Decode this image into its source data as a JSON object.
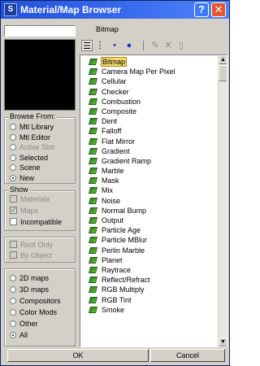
{
  "window": {
    "title": "Material/Map Browser",
    "help_label": "?",
    "close_label": "✕",
    "icon_label": "S"
  },
  "path": "Bitmap",
  "browse_from": {
    "title": "Browse From:",
    "options": [
      {
        "label": "Mtl Library",
        "selected": false,
        "enabled": true
      },
      {
        "label": "Mtl Editor",
        "selected": false,
        "enabled": true
      },
      {
        "label": "Active Slot",
        "selected": false,
        "enabled": false
      },
      {
        "label": "Selected",
        "selected": false,
        "enabled": true
      },
      {
        "label": "Scene",
        "selected": false,
        "enabled": true
      },
      {
        "label": "New",
        "selected": true,
        "enabled": true
      }
    ]
  },
  "show": {
    "title": "Show",
    "options": [
      {
        "label": "Materials",
        "checked": false,
        "enabled": false
      },
      {
        "label": "Maps",
        "checked": true,
        "enabled": false
      },
      {
        "label": "Incompatible",
        "checked": false,
        "enabled": true
      }
    ]
  },
  "filters": {
    "options": [
      {
        "label": "Root Only",
        "checked": false,
        "enabled": false
      },
      {
        "label": "By Object",
        "checked": false,
        "enabled": false
      }
    ]
  },
  "map_type": {
    "options": [
      {
        "label": "2D maps",
        "selected": false
      },
      {
        "label": "3D maps",
        "selected": false
      },
      {
        "label": "Compositors",
        "selected": false
      },
      {
        "label": "Color Mods",
        "selected": false
      },
      {
        "label": "Other",
        "selected": false
      },
      {
        "label": "All",
        "selected": true
      }
    ]
  },
  "toolbar": {
    "icons": [
      "view-list-icon",
      "view-list-icons-icon",
      "view-small-icons-icon",
      "view-large-icons-icon",
      "update-scene-materials-icon",
      "delete-icon",
      "clear-library-icon"
    ]
  },
  "maps": [
    "Bitmap",
    "Camera Map Per Pixel",
    "Cellular",
    "Checker",
    "Combustion",
    "Composite",
    "Dent",
    "Falloff",
    "Flat Mirror",
    "Gradient",
    "Gradient Ramp",
    "Marble",
    "Mask",
    "Mix",
    "Noise",
    "Normal Bump",
    "Output",
    "Particle Age",
    "Particle MBlur",
    "Perlin Marble",
    "Planet",
    "Raytrace",
    "Reflect/Refract",
    "RGB Multiply",
    "RGB Tint",
    "Smoke"
  ],
  "selected_map": "Bitmap",
  "buttons": {
    "ok": "OK",
    "cancel": "Cancel"
  },
  "colors": {
    "title_bar": "#2350d8",
    "selection": "#f3d86a",
    "face": "#d4d0c8"
  }
}
